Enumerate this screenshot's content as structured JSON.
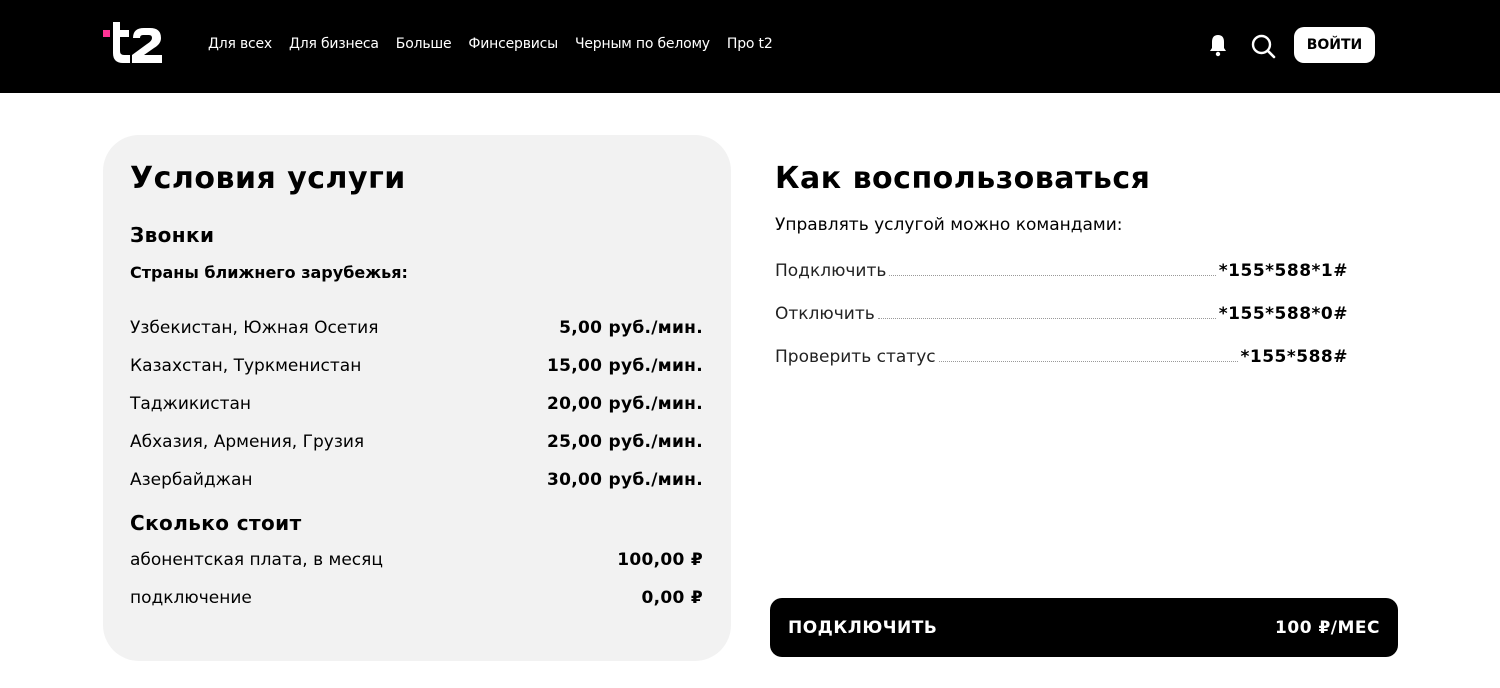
{
  "header": {
    "logo_text": "t2",
    "nav": [
      "Для всех",
      "Для бизнеса",
      "Больше",
      "Финсервисы",
      "Черным по белому",
      "Про t2"
    ],
    "login_label": "ВОЙТИ"
  },
  "colors": {
    "header_bg": "#000000",
    "brand_accent": "#ff3495",
    "card_bg": "#f2f2f2"
  },
  "conditions": {
    "title": "Условия услуги",
    "calls_title": "Звонки",
    "countries_subhead": "Страны ближнего зарубежья:",
    "rates": [
      {
        "label": "Узбекистан, Южная Осетия",
        "value": "5,00 руб./мин."
      },
      {
        "label": "Казахстан, Туркменистан",
        "value": "15,00 руб./мин."
      },
      {
        "label": "Таджикистан",
        "value": "20,00 руб./мин."
      },
      {
        "label": "Абхазия, Армения, Грузия",
        "value": "25,00 руб./мин."
      },
      {
        "label": "Азербайджан",
        "value": "30,00 руб./мин."
      }
    ],
    "cost_title": "Сколько стоит",
    "costs": [
      {
        "label": "абонентская плата, в месяц",
        "value": "100,00 ₽"
      },
      {
        "label": "подключение",
        "value": "0,00 ₽"
      }
    ]
  },
  "howto": {
    "title": "Как воспользоваться",
    "intro": "Управлять услугой можно командами:",
    "commands": [
      {
        "label": "Подключить",
        "code": "*155*588*1#"
      },
      {
        "label": "Отключить",
        "code": "*155*588*0#"
      },
      {
        "label": "Проверить статус",
        "code": "*155*588#"
      }
    ]
  },
  "connect": {
    "label": "ПОДКЛЮЧИТЬ",
    "price": "100 ₽/МЕС"
  }
}
